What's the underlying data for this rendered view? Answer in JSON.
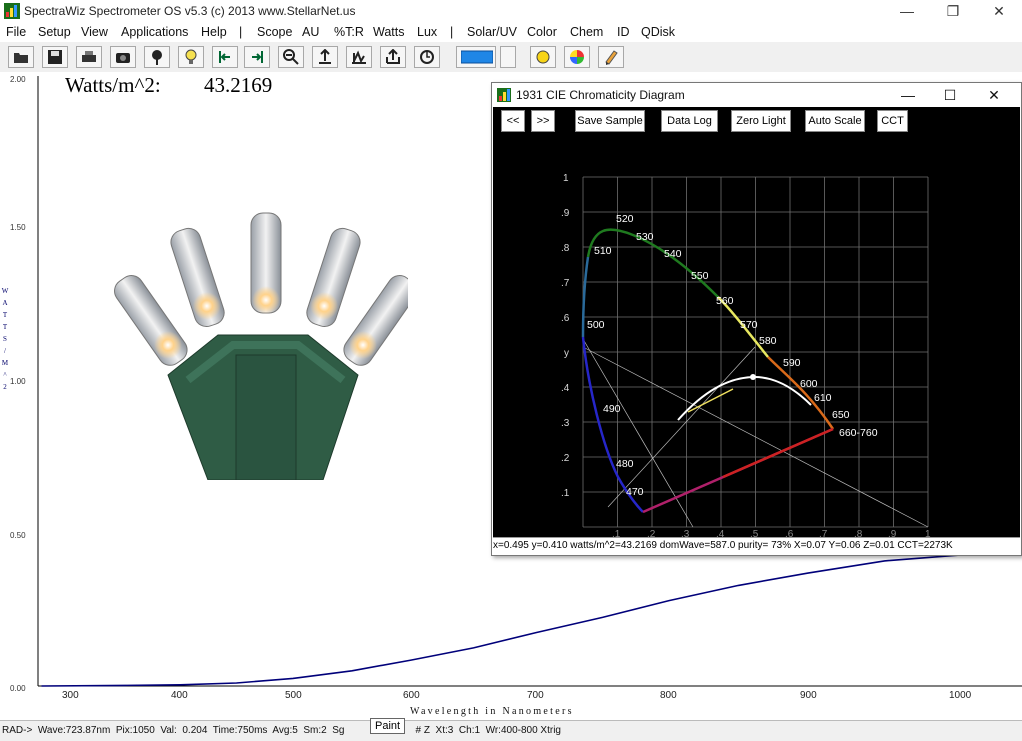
{
  "window": {
    "title": "SpectraWiz  Spectrometer OS v5.3 (c) 2013    www.StellarNet.us",
    "minimize": "—",
    "restore": "❐",
    "close": "✕"
  },
  "menu": [
    "File",
    "Setup",
    "View",
    "Applications",
    "Help",
    "|",
    "Scope",
    "AU",
    "%T:R",
    "Watts",
    "Lux",
    "|",
    "Solar/UV",
    "Color",
    "Chem",
    "ID",
    "QDisk"
  ],
  "toolbar": [
    "open-icon",
    "save-icon",
    "print-icon",
    "camera-icon",
    "probe-icon",
    "lamp-icon",
    "scroll-left-icon",
    "scroll-right-icon",
    "zoom-out-icon",
    "autoscale-icon",
    "peak-icon",
    "export-icon",
    "clock-icon",
    "bar-icon",
    "sun-icon",
    "color-wheel-icon",
    "pencil-icon"
  ],
  "readout": {
    "label": "Watts/m^2:",
    "value": "43.2169"
  },
  "plot": {
    "y_label": [
      "W",
      "A",
      "T",
      "T",
      "S",
      "",
      "/",
      "M",
      "^",
      "2"
    ],
    "x_label": "Wavelength in Nanometers",
    "y_ticks": [
      "2.00",
      "1.50",
      "1.00",
      "0.50",
      "0.00"
    ],
    "x_ticks": [
      "300",
      "400",
      "500",
      "600",
      "700",
      "800",
      "900",
      "1000"
    ]
  },
  "chart_data": {
    "type": "line",
    "xlabel": "Wavelength in Nanometers",
    "ylabel": "WATTS / M^2",
    "xlim": [
      272,
      1022
    ],
    "ylim": [
      0,
      2
    ],
    "series": [
      {
        "x": [
          275,
          350,
          400,
          450,
          500,
          550,
          600,
          650,
          700,
          750,
          800,
          850,
          900,
          950,
          1000,
          1022
        ],
        "y": [
          0.0,
          0.002,
          0.004,
          0.01,
          0.025,
          0.05,
          0.085,
          0.125,
          0.175,
          0.225,
          0.28,
          0.33,
          0.37,
          0.41,
          0.43,
          0.47
        ],
        "color": "#00007a"
      }
    ]
  },
  "cie": {
    "title": "1931 CIE Chromaticity Diagram",
    "minimize": "—",
    "maximize": "☐",
    "close": "✕",
    "buttons": [
      "<<",
      ">>",
      "Save Sample",
      "Data Log",
      "Zero Light",
      "Auto Scale",
      "CCT"
    ],
    "y_ticks": [
      "1",
      ".9",
      ".8",
      ".7",
      ".6",
      "y",
      ".4",
      ".3",
      ".2",
      ".1"
    ],
    "x_ticks": [
      ".1",
      ".2",
      ".3",
      ".4",
      ".5",
      ".6",
      ".7",
      ".8",
      ".9",
      "1"
    ],
    "wavelengths": [
      "520",
      "530",
      "510",
      "540",
      "550",
      "560",
      "500",
      "570",
      "580",
      "590",
      "600",
      "610",
      "490",
      "650",
      "660-760",
      "480",
      "470"
    ],
    "status": "x=0.495 y=0.410 watts/m^2=43.2169  domWave=587.0  purity= 73%  X=0.07  Y=0.06  Z=0.01 CCT=2273K"
  },
  "status": {
    "left": "RAD->  Wave:723.87nm  Pix:1050  Val:  0.204  Time:750ms  Avg:5  Sm:2  Sg",
    "tooltip": "Paint",
    "right": "  # Z  Xt:3  Ch:1  Wr:400-800 Xtrig"
  },
  "colors": {
    "spectrum": "#00007a",
    "cie_bg": "#000000",
    "grid": "#777777",
    "planck": "#ffffff"
  }
}
